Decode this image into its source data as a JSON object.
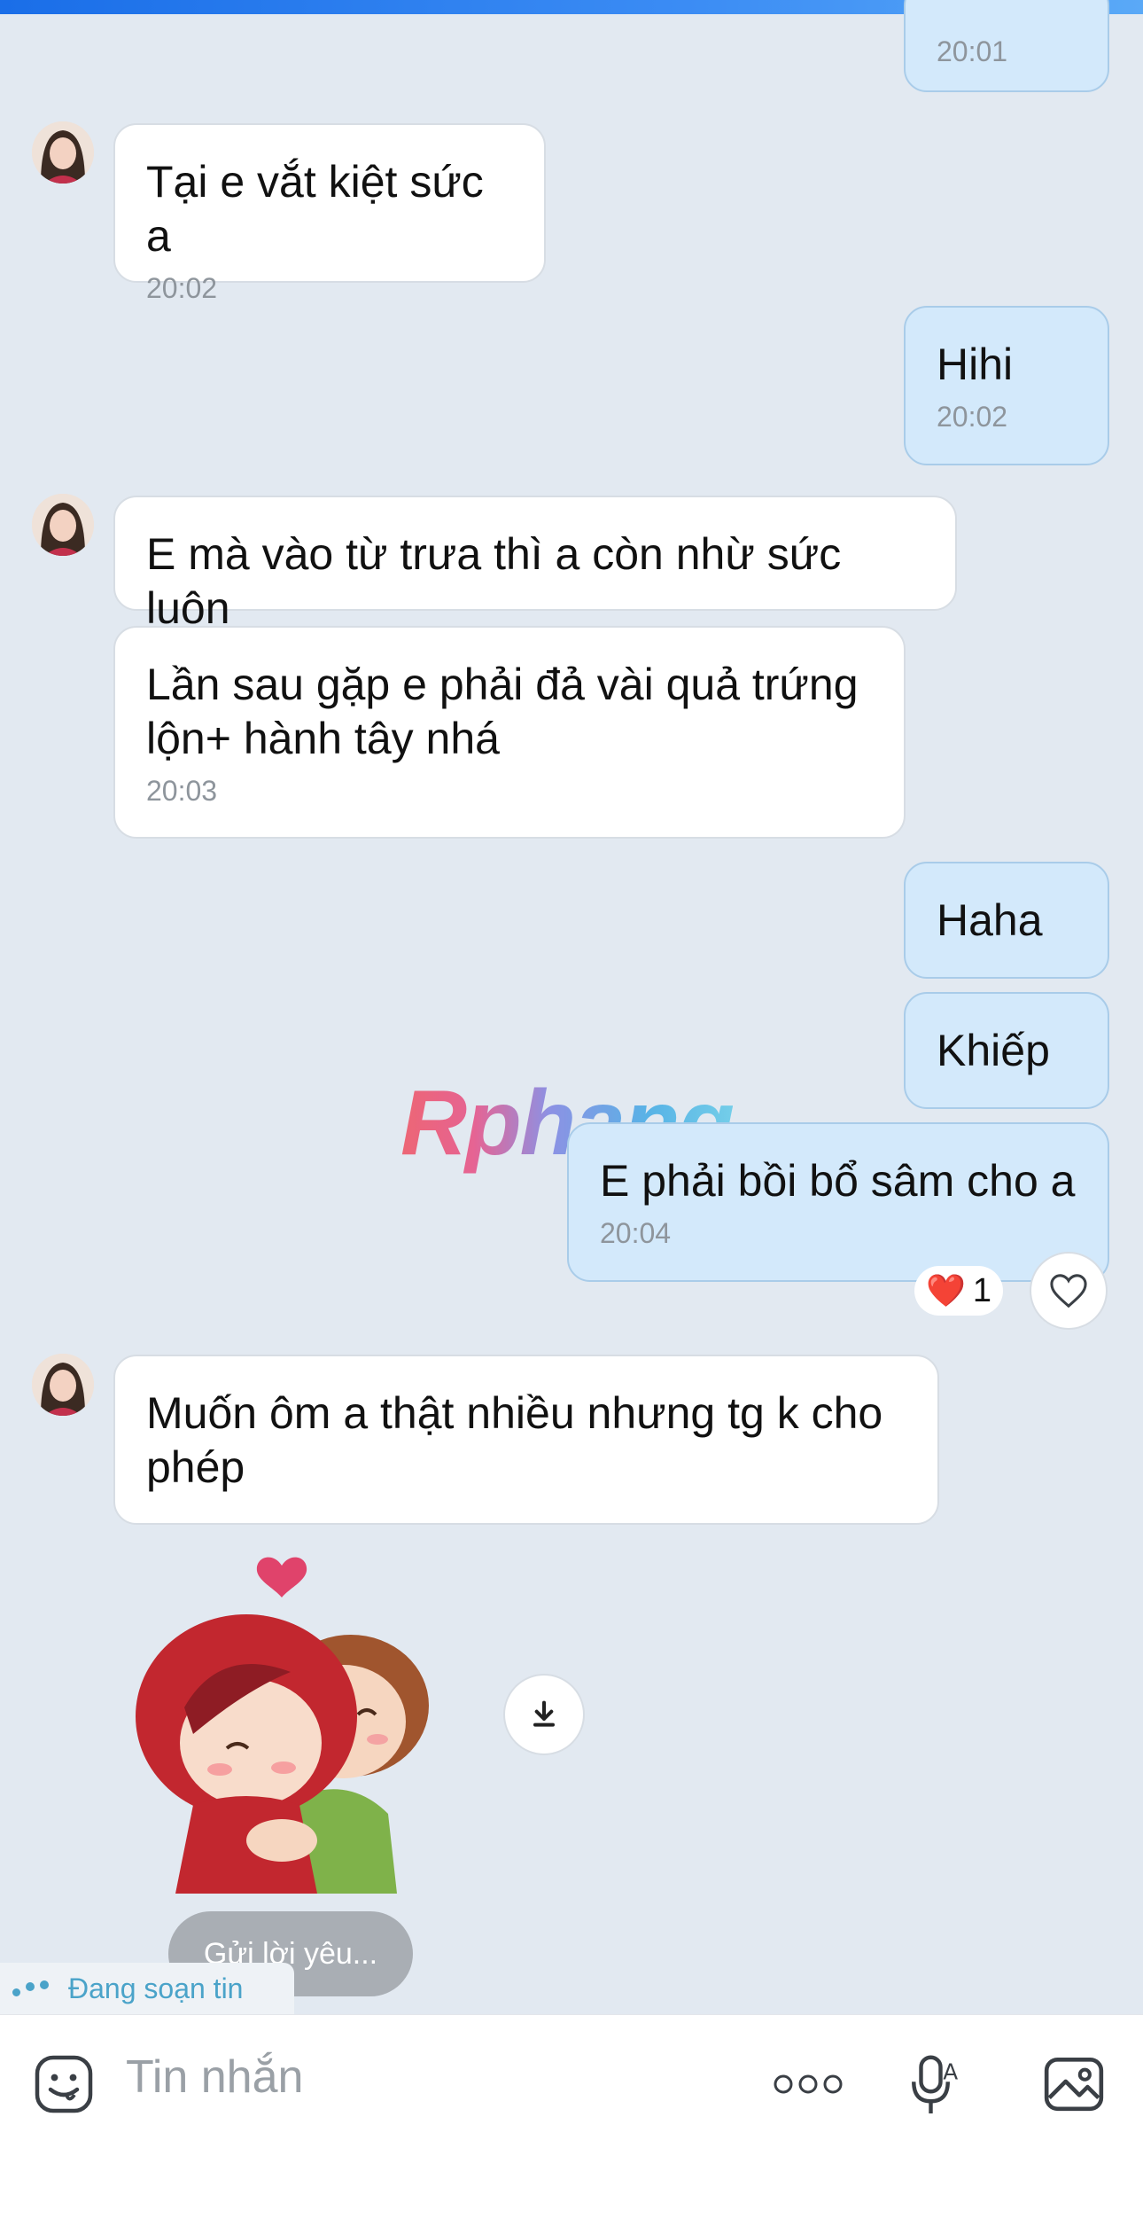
{
  "messages": [
    {
      "text": "",
      "time": "20:01"
    },
    {
      "text": "Tại e vắt kiệt sức a",
      "time": "20:02"
    },
    {
      "text": "Hihi",
      "time": "20:02"
    },
    {
      "text": "E mà vào từ trưa thì a còn nhừ sức luôn",
      "time": ""
    },
    {
      "text": "Lần sau gặp e phải đả vài quả trứng\nlộn+ hành tây nhá",
      "time": "20:03"
    },
    {
      "text": "Haha",
      "time": ""
    },
    {
      "text": "Khiếp",
      "time": ""
    },
    {
      "text": "E phải bồi bổ sâm cho a",
      "time": "20:04"
    },
    {
      "text": "Muốn ôm a thật nhiều nhưng tg k cho\nphép",
      "time": ""
    }
  ],
  "reaction": {
    "emoji": "❤️",
    "count": "1"
  },
  "watermark": "Rphang",
  "quick_reply": "Gửi lời yêu...",
  "typing_status": "Đang soạn tin",
  "composer": {
    "placeholder": "Tin nhắn"
  },
  "icons": {
    "emoji": "emoji-icon",
    "more": "more-icon",
    "voice": "microphone-icon",
    "image": "image-icon",
    "like": "heart-outline-icon",
    "download": "download-icon"
  },
  "colors": {
    "incoming": "#ffffff",
    "outgoing": "#d3e9fb",
    "background": "#e2e9f1",
    "typing": "#4aa3c9"
  }
}
